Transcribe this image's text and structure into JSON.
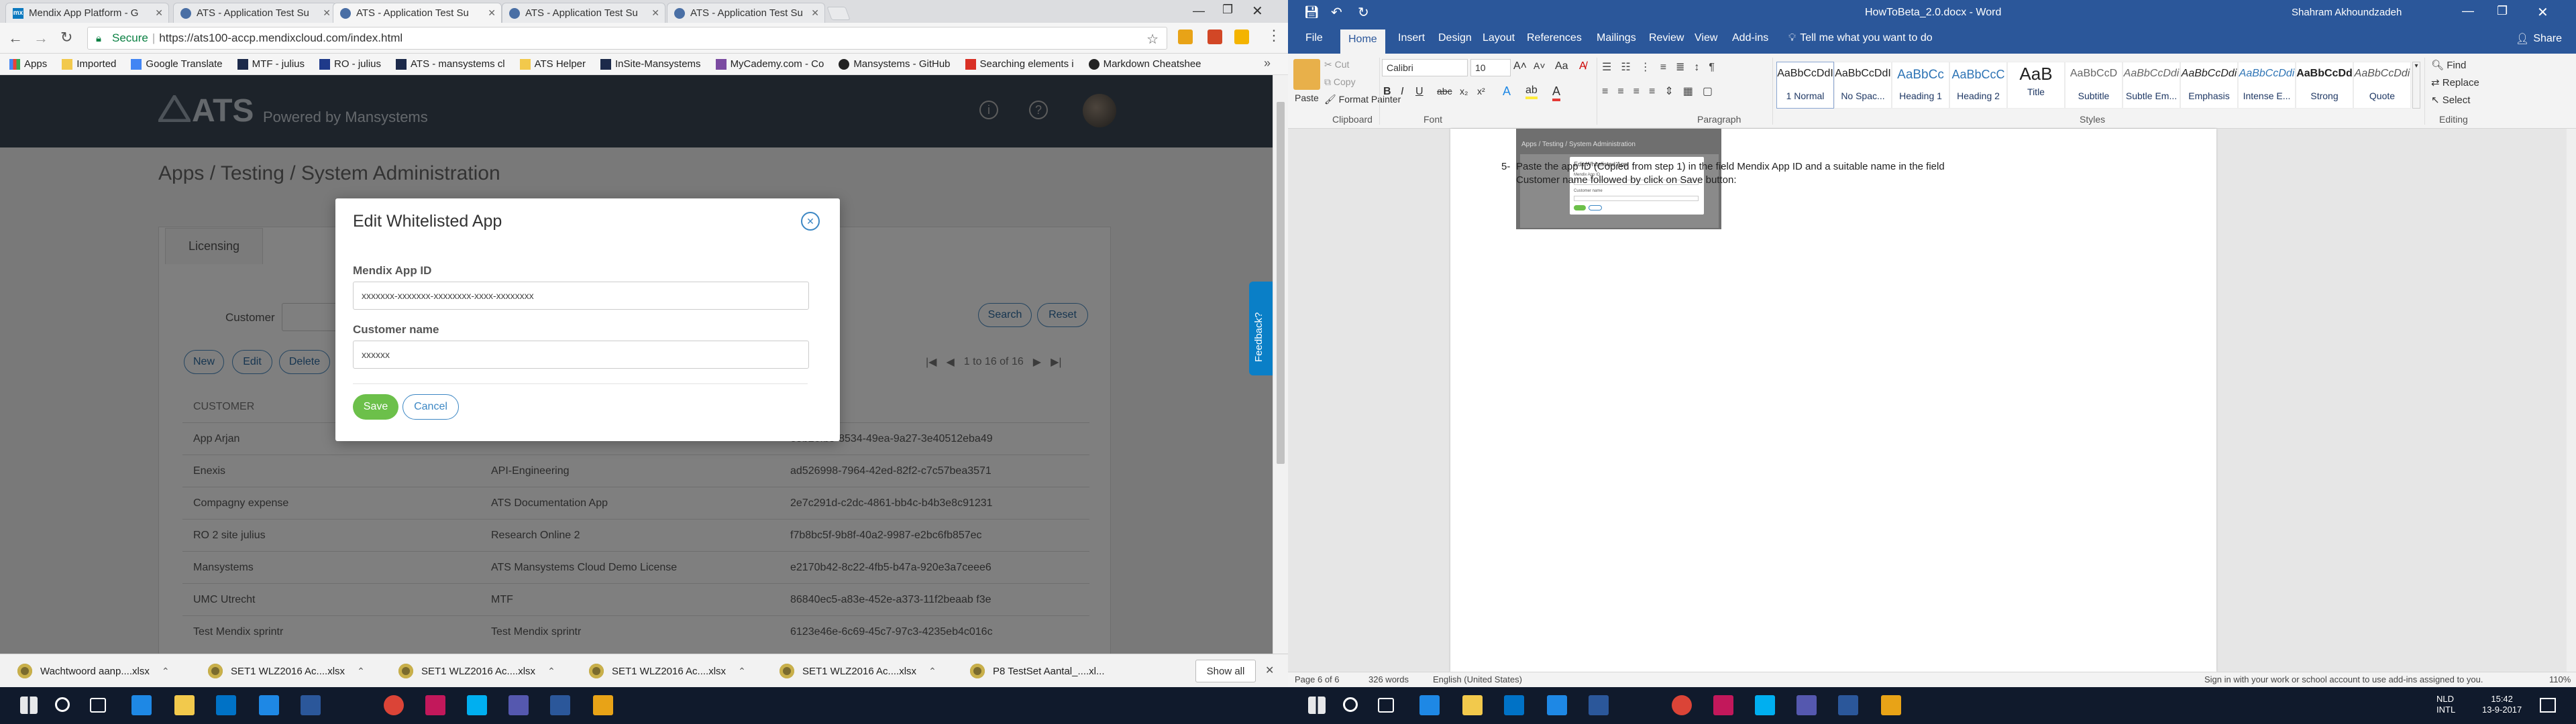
{
  "chrome": {
    "tabs": [
      {
        "title": "Mendix App Platform - G",
        "active": false
      },
      {
        "title": "ATS - Application Test Su",
        "active": false
      },
      {
        "title": "ATS - Application Test Su",
        "active": true
      },
      {
        "title": "ATS - Application Test Su",
        "active": false
      },
      {
        "title": "ATS - Application Test Su",
        "active": false
      }
    ],
    "secure_label": "Secure",
    "url": "https://ats100-accp.mendixcloud.com/index.html",
    "bookmarks": [
      "Apps",
      "Imported",
      "Google Translate",
      "MTF - julius",
      "RO - julius",
      "ATS - mansystems cl",
      "ATS Helper",
      "InSite-Mansystems",
      "MyCademy.com - Co",
      "Mansystems - GitHub",
      "Searching elements i",
      "Markdown Cheatshee"
    ]
  },
  "ats": {
    "brand": "ATS",
    "tagline": "Powered by Mansystems",
    "breadcrumb": "Apps / Testing / System Administration",
    "tab_licensing": "Licensing",
    "customer_label": "Customer",
    "buttons": {
      "new": "New",
      "edit": "Edit",
      "delete": "Delete",
      "search": "Search",
      "reset": "Reset"
    },
    "pagination": "1 to 16 of 16",
    "column_customer": "CUSTOMER",
    "feedback": "Feedback?",
    "rows": [
      {
        "customer": "App Arjan",
        "app": "",
        "id": "e5b26fb5-8534-49ea-9a27-3e40512eba49"
      },
      {
        "customer": "Enexis",
        "app": "API-Engineering",
        "id": "ad526998-7964-42ed-82f2-c7c57bea3571"
      },
      {
        "customer": "Compagny expense",
        "app": "ATS Documentation App",
        "id": "2e7c291d-c2dc-4861-bb4c-b4b3e8c91231"
      },
      {
        "customer": "RO 2 site julius",
        "app": "Research Online 2",
        "id": "f7b8bc5f-9b8f-40a2-9987-e2bc6fb857ec"
      },
      {
        "customer": "Mansystems",
        "app": "ATS Mansystems Cloud Demo License",
        "id": "e2170b42-8c22-4fb5-b47a-920e3a7ceee6"
      },
      {
        "customer": "UMC Utrecht",
        "app": "MTF",
        "id": "86840ec5-a83e-452e-a373-11f2beaab f3e"
      },
      {
        "customer": "Test Mendix sprintr",
        "app": "Test Mendix sprintr",
        "id": "6123e46e-6c69-45c7-97c3-4235eb4c016c"
      }
    ]
  },
  "modal": {
    "title": "Edit Whitelisted App",
    "app_id_label": "Mendix App ID",
    "app_id_value": "xxxxxxx-xxxxxxx-xxxxxxxx-xxxx-xxxxxxxx",
    "customer_label": "Customer name",
    "customer_value": "xxxxxx",
    "save": "Save",
    "cancel": "Cancel"
  },
  "downloads": {
    "items": [
      "Wachtwoord aanp....xlsx",
      "SET1 WLZ2016 Ac....xlsx",
      "SET1 WLZ2016 Ac....xlsx",
      "SET1 WLZ2016 Ac....xlsx",
      "SET1 WLZ2016 Ac....xlsx",
      "P8 TestSet Aantal_....xl..."
    ],
    "show_all": "Show all"
  },
  "word": {
    "doc_title": "HowToBeta_2.0.docx - Word",
    "user": "Shahram Akhoundzadeh",
    "tabs": [
      "File",
      "Home",
      "Insert",
      "Design",
      "Layout",
      "References",
      "Mailings",
      "Review",
      "View",
      "Add-ins"
    ],
    "tell_me": "Tell me what you want to do",
    "share": "Share",
    "clipboard": {
      "paste": "Paste",
      "cut": "Cut",
      "copy": "Copy",
      "format_painter": "Format Painter",
      "group": "Clipboard"
    },
    "font": {
      "name": "Calibri",
      "size": "10",
      "group": "Font"
    },
    "paragraph_group": "Paragraph",
    "styles_group": "Styles",
    "editing": {
      "find": "Find",
      "replace": "Replace",
      "select": "Select",
      "group": "Editing"
    },
    "styles": [
      {
        "preview": "AaBbCcDdI",
        "name": "1 Normal"
      },
      {
        "preview": "AaBbCcDdI",
        "name": "No Spac..."
      },
      {
        "preview": "AaBbCc",
        "name": "Heading 1"
      },
      {
        "preview": "AaBbCcC",
        "name": "Heading 2"
      },
      {
        "preview": "AaB",
        "name": "Title"
      },
      {
        "preview": "AaBbCcD",
        "name": "Subtitle"
      },
      {
        "preview": "AaBbCcDdi",
        "name": "Subtle Em..."
      },
      {
        "preview": "AaBbCcDdi",
        "name": "Emphasis"
      },
      {
        "preview": "AaBbCcDdi",
        "name": "Intense E..."
      },
      {
        "preview": "AaBbCcDd",
        "name": "Strong"
      },
      {
        "preview": "AaBbCcDdi",
        "name": "Quote"
      }
    ],
    "screenshot_breadcrumb": "Apps / Testing / System Administration",
    "step_number": "5-",
    "step_line1": "Paste the app ID (Copied from step 1) in the field Mendix App ID and a suitable name in the field",
    "step_line2": "Customer name followed by click on Save button:",
    "status": {
      "page": "Page 6 of 6",
      "words": "326 words",
      "language": "English (United States)",
      "addin_msg": "Sign in with your work or school account to use add-ins assigned to you.",
      "zoom": "110%"
    }
  },
  "taskbar": {
    "right_lang": "NLD",
    "right_kb": "INTL",
    "right_time": "15:42",
    "right_date": "13-9-2017"
  }
}
